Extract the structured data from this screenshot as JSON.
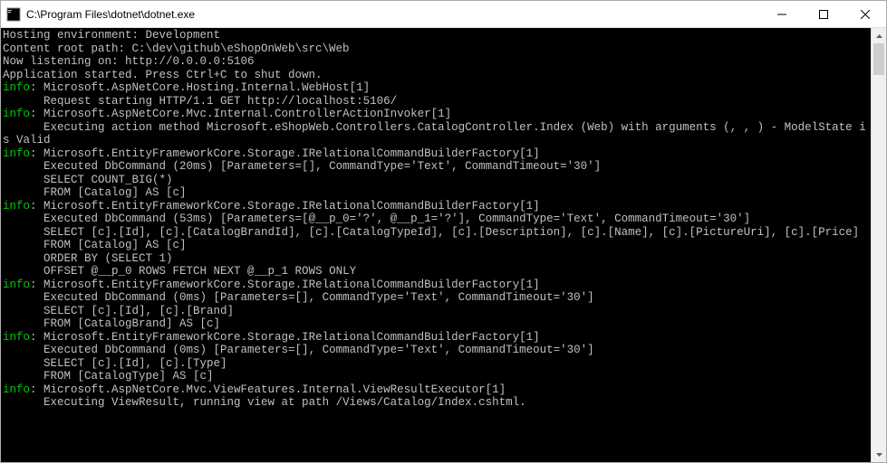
{
  "window": {
    "title": "C:\\Program Files\\dotnet\\dotnet.exe"
  },
  "console": {
    "intro": [
      "Hosting environment: Development",
      "Content root path: C:\\dev\\github\\eShopOnWeb\\src\\Web",
      "Now listening on: http://0.0.0.0:5106",
      "Application started. Press Ctrl+C to shut down."
    ],
    "entries": [
      {
        "level": "info",
        "category": "Microsoft.AspNetCore.Hosting.Internal.WebHost[1]",
        "lines": [
          "Request starting HTTP/1.1 GET http://localhost:5106/"
        ]
      },
      {
        "level": "info",
        "category": "Microsoft.AspNetCore.Mvc.Internal.ControllerActionInvoker[1]",
        "lines": [
          "Executing action method Microsoft.eShopWeb.Controllers.CatalogController.Index (Web) with arguments (, , ) - ModelState is Valid"
        ]
      },
      {
        "level": "info",
        "category": "Microsoft.EntityFrameworkCore.Storage.IRelationalCommandBuilderFactory[1]",
        "lines": [
          "Executed DbCommand (20ms) [Parameters=[], CommandType='Text', CommandTimeout='30']",
          "SELECT COUNT_BIG(*)",
          "FROM [Catalog] AS [c]"
        ]
      },
      {
        "level": "info",
        "category": "Microsoft.EntityFrameworkCore.Storage.IRelationalCommandBuilderFactory[1]",
        "lines": [
          "Executed DbCommand (53ms) [Parameters=[@__p_0='?', @__p_1='?'], CommandType='Text', CommandTimeout='30']",
          "SELECT [c].[Id], [c].[CatalogBrandId], [c].[CatalogTypeId], [c].[Description], [c].[Name], [c].[PictureUri], [c].[Price]",
          "FROM [Catalog] AS [c]",
          "ORDER BY (SELECT 1)",
          "OFFSET @__p_0 ROWS FETCH NEXT @__p_1 ROWS ONLY"
        ]
      },
      {
        "level": "info",
        "category": "Microsoft.EntityFrameworkCore.Storage.IRelationalCommandBuilderFactory[1]",
        "lines": [
          "Executed DbCommand (0ms) [Parameters=[], CommandType='Text', CommandTimeout='30']",
          "SELECT [c].[Id], [c].[Brand]",
          "FROM [CatalogBrand] AS [c]"
        ]
      },
      {
        "level": "info",
        "category": "Microsoft.EntityFrameworkCore.Storage.IRelationalCommandBuilderFactory[1]",
        "lines": [
          "Executed DbCommand (0ms) [Parameters=[], CommandType='Text', CommandTimeout='30']",
          "SELECT [c].[Id], [c].[Type]",
          "FROM [CatalogType] AS [c]"
        ]
      },
      {
        "level": "info",
        "category": "Microsoft.AspNetCore.Mvc.ViewFeatures.Internal.ViewResultExecutor[1]",
        "lines": [
          "Executing ViewResult, running view at path /Views/Catalog/Index.cshtml."
        ]
      }
    ]
  }
}
